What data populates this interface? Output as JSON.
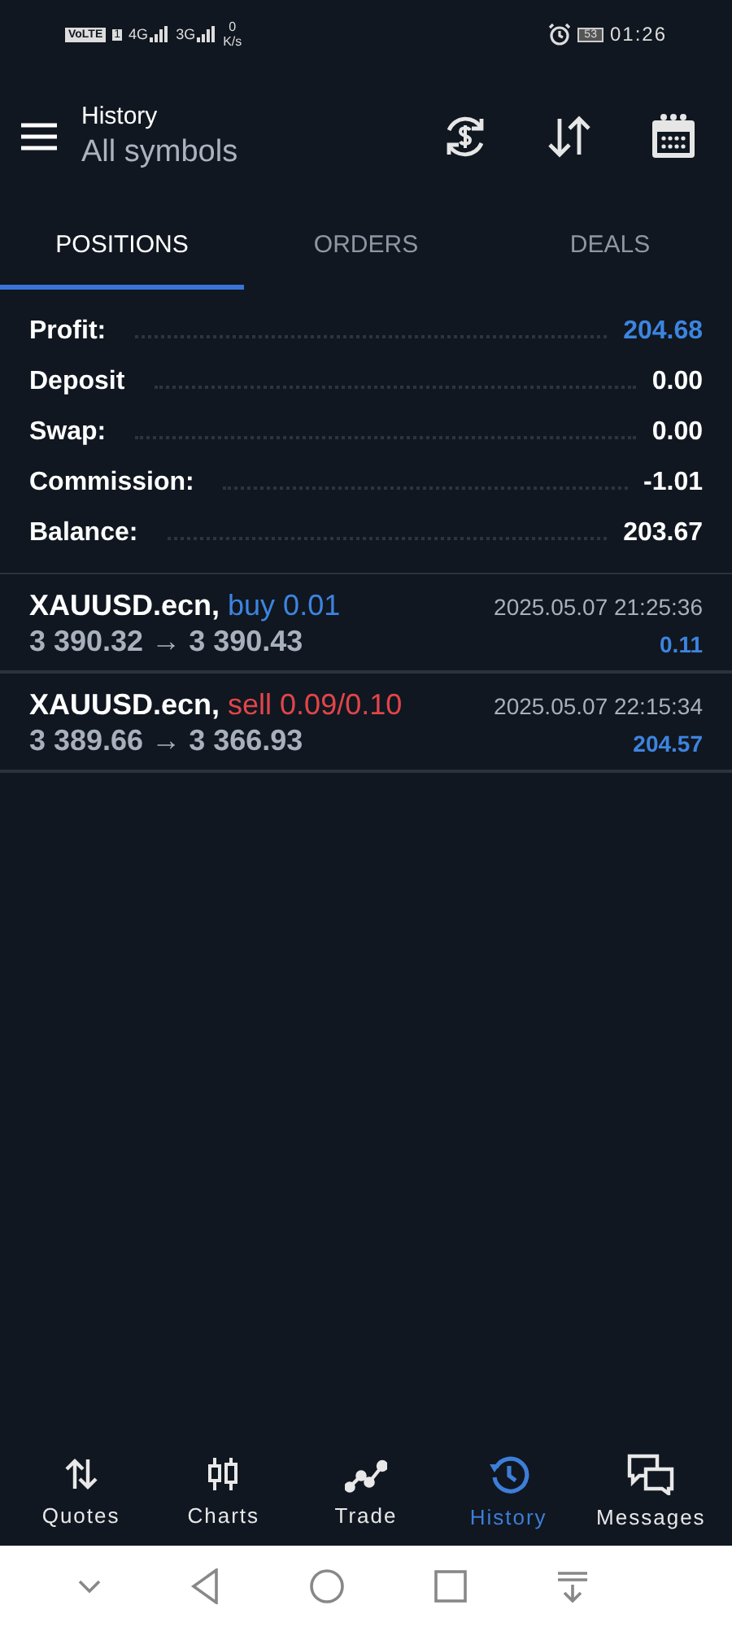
{
  "status_bar": {
    "volte": "VoLTE",
    "sim": "1",
    "net_4g": "4G",
    "net_3g": "3G",
    "speed_value": "0",
    "speed_unit": "K/s",
    "battery": "53",
    "time": "01:26"
  },
  "toolbar": {
    "title": "History",
    "subtitle": "All symbols"
  },
  "tabs": [
    {
      "label": "POSITIONS",
      "selected": true
    },
    {
      "label": "ORDERS",
      "selected": false
    },
    {
      "label": "DEALS",
      "selected": false
    }
  ],
  "summary": [
    {
      "label": "Profit:",
      "value": "204.68",
      "highlight": true
    },
    {
      "label": "Deposit",
      "value": "0.00",
      "highlight": false
    },
    {
      "label": "Swap:",
      "value": "0.00",
      "highlight": false
    },
    {
      "label": "Commission:",
      "value": "-1.01",
      "highlight": false
    },
    {
      "label": "Balance:",
      "value": "203.67",
      "highlight": false
    }
  ],
  "positions": [
    {
      "symbol": "XAUUSD.ecn,",
      "kind": "buy",
      "volume": "buy 0.01",
      "prices": "3 390.32 → 3 390.43",
      "time": "2025.05.07 21:25:36",
      "profit": "0.11"
    },
    {
      "symbol": "XAUUSD.ecn,",
      "kind": "sell",
      "volume": "sell 0.09/0.10",
      "prices": "3 389.66 → 3 366.93",
      "time": "2025.05.07 22:15:34",
      "profit": "204.57"
    }
  ],
  "bottom_nav": [
    {
      "label": "Quotes",
      "kind": "quotes",
      "selected": false
    },
    {
      "label": "Charts",
      "kind": "charts",
      "selected": false
    },
    {
      "label": "Trade",
      "kind": "trade",
      "selected": false
    },
    {
      "label": "History",
      "kind": "history",
      "selected": true
    },
    {
      "label": "Messages",
      "kind": "messages",
      "selected": false
    }
  ]
}
